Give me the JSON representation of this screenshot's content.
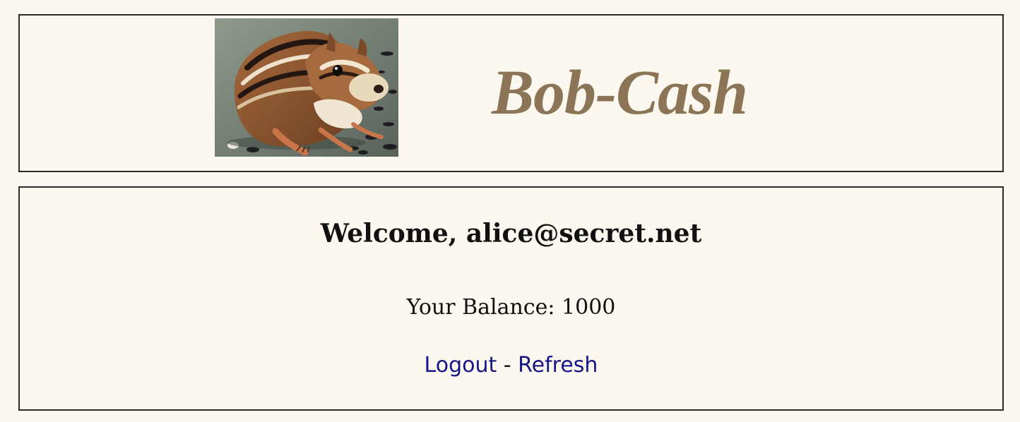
{
  "header": {
    "title": "Bob-Cash",
    "logo": "chipmunk-photo"
  },
  "main": {
    "welcome_prefix": "Welcome, ",
    "user_email": "alice@secret.net",
    "balance_label": "Your Balance: ",
    "balance_value": "1000",
    "links": {
      "logout": "Logout",
      "separator": " - ",
      "refresh": "Refresh"
    }
  },
  "colors": {
    "background": "#fdf8ef",
    "title": "#8b7556",
    "link": "#15158a"
  }
}
